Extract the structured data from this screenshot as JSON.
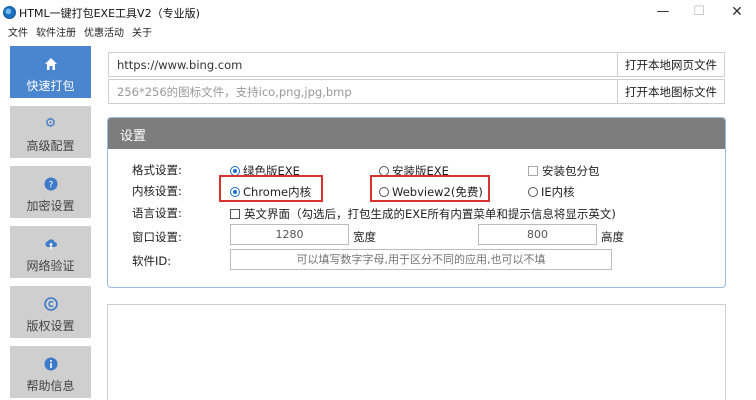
{
  "window": {
    "title": "HTML一键打包EXE工具V2（专业版)",
    "controls": {
      "minimize": "—",
      "maximize": "☐",
      "close": "✕"
    }
  },
  "menu": [
    "文件",
    "软件注册",
    "优惠活动",
    "关于"
  ],
  "sidebar": [
    {
      "label": "快速打包",
      "icon": "home-icon",
      "active": true
    },
    {
      "label": "高级配置",
      "icon": "gear-icon",
      "active": false
    },
    {
      "label": "加密设置",
      "icon": "help-circle-icon",
      "active": false
    },
    {
      "label": "网络验证",
      "icon": "upload-cloud-icon",
      "active": false
    },
    {
      "label": "版权设置",
      "icon": "copyright-icon",
      "active": false
    },
    {
      "label": "帮助信息",
      "icon": "info-icon",
      "active": false
    }
  ],
  "url_row": {
    "value": "https://www.bing.com",
    "button": "打开本地网页文件"
  },
  "icon_row": {
    "placeholder": "256*256的图标文件，支持ico,png,jpg,bmp",
    "button": "打开本地图标文件"
  },
  "settings": {
    "title": "设置",
    "format": {
      "label": "格式设置:",
      "opt1": "绿色版EXE",
      "opt2": "安装版EXE",
      "opt3": "安装包分包"
    },
    "kernel": {
      "label": "内核设置:",
      "opt1": "Chrome内核",
      "opt2": "Webview2(免费)",
      "opt3": "IE内核"
    },
    "language": {
      "label": "语言设置:",
      "option": "英文界面（勾选后，打包生成的EXE所有内置菜单和提示信息将显示英文)"
    },
    "window": {
      "label": "窗口设置:",
      "width": "1280",
      "width_unit": "宽度",
      "height": "800",
      "height_unit": "高度"
    },
    "software_id": {
      "label": "软件ID:",
      "placeholder": "可以填写数字字母,用于区分不同的应用,也可以不填"
    }
  },
  "colors": {
    "accent": "#4a86cf",
    "highlight": "#d8312f",
    "panel_header": "#7d7d7d"
  }
}
